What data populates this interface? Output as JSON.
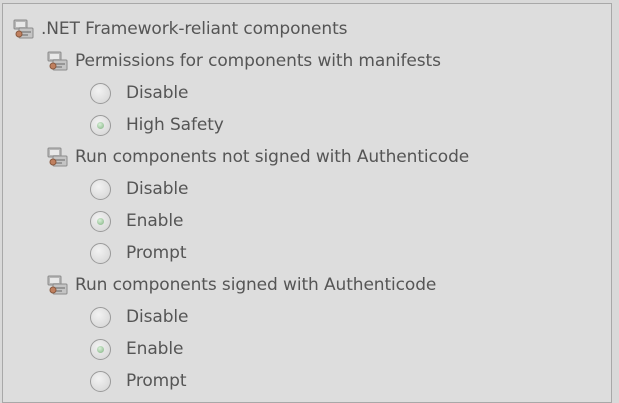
{
  "tree": {
    "root_label": ".NET Framework-reliant components",
    "groups": [
      {
        "label": "Permissions for components with manifests",
        "options": [
          {
            "label": "Disable",
            "checked": false
          },
          {
            "label": "High Safety",
            "checked": true
          }
        ]
      },
      {
        "label": "Run components not signed with Authenticode",
        "options": [
          {
            "label": "Disable",
            "checked": false
          },
          {
            "label": "Enable",
            "checked": true
          },
          {
            "label": "Prompt",
            "checked": false
          }
        ]
      },
      {
        "label": "Run components signed with Authenticode",
        "options": [
          {
            "label": "Disable",
            "checked": false
          },
          {
            "label": "Enable",
            "checked": true
          },
          {
            "label": "Prompt",
            "checked": false
          }
        ]
      }
    ]
  },
  "icons": {
    "setting": "settings-group-icon",
    "radio": "radio-button"
  },
  "colors": {
    "background": "#dddddd",
    "text": "#555555",
    "radio_checked_dot": "#7fb07f"
  }
}
